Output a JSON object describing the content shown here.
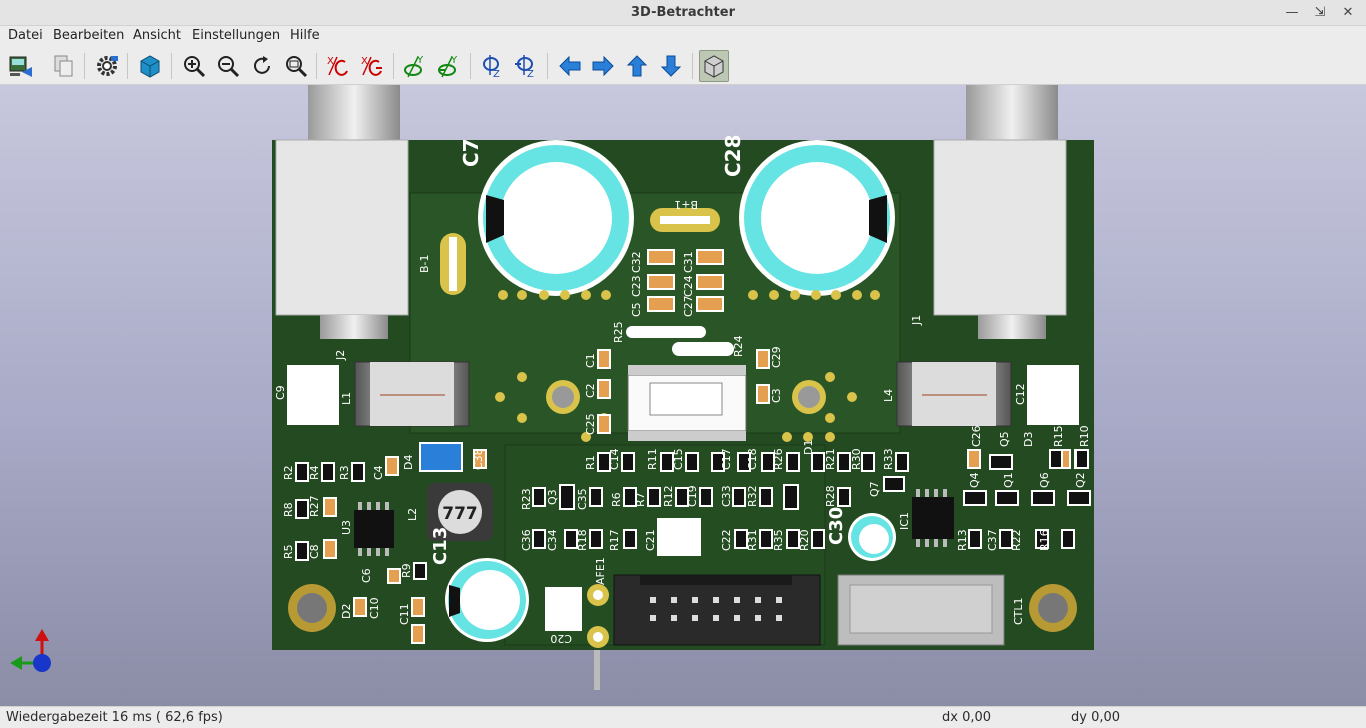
{
  "window": {
    "title": "3D-Betrachter"
  },
  "menu": {
    "items": [
      "Datei",
      "Bearbeiten",
      "Ansicht",
      "Einstellungen",
      "Hilfe"
    ]
  },
  "toolbar": {
    "buttons": [
      {
        "name": "pcb-export-icon"
      },
      {
        "name": "copy-icon"
      },
      {
        "name": "settings-gear-icon"
      },
      {
        "name": "3d-box-icon"
      },
      {
        "name": "zoom-in-icon"
      },
      {
        "name": "zoom-out-icon"
      },
      {
        "name": "redraw-icon"
      },
      {
        "name": "zoom-fit-icon"
      },
      {
        "name": "rotate-x-cw-icon"
      },
      {
        "name": "rotate-x-ccw-icon"
      },
      {
        "name": "rotate-y-cw-icon"
      },
      {
        "name": "rotate-y-ccw-icon"
      },
      {
        "name": "rotate-z-cw-icon"
      },
      {
        "name": "rotate-z-ccw-icon"
      },
      {
        "name": "move-left-icon"
      },
      {
        "name": "move-right-icon"
      },
      {
        "name": "move-up-icon"
      },
      {
        "name": "move-down-icon"
      },
      {
        "name": "orthographic-toggle-icon",
        "active": true
      }
    ]
  },
  "board": {
    "silkscreen": [
      "C7",
      "C28",
      "B+1",
      "B-1",
      "C32",
      "C23",
      "C5",
      "C31",
      "C24",
      "C27",
      "R25",
      "R24",
      "C1",
      "C29",
      "C2",
      "C3",
      "C25",
      "J2",
      "J1",
      "C9",
      "L1",
      "L4",
      "C12",
      "C26",
      "Q5",
      "D3",
      "R15",
      "R10",
      "R2",
      "R4",
      "R3",
      "C4",
      "D4",
      "C38",
      "R1",
      "C14",
      "R11",
      "C15",
      "C17",
      "C18",
      "R26",
      "D1",
      "R21",
      "R30",
      "R33",
      "R23",
      "C35",
      "Q3",
      "R6",
      "R7",
      "R12",
      "C19",
      "C33",
      "R32",
      "R28",
      "Q7",
      "Q4",
      "Q1",
      "Q6",
      "Q2",
      "R8",
      "R27",
      "U3",
      "L2",
      "C36",
      "C34",
      "R18",
      "R17",
      "C21",
      "C22",
      "R31",
      "R35",
      "R20",
      "C30",
      "IC1",
      "R13",
      "C37",
      "R22",
      "R16",
      "R5",
      "C8",
      "C13",
      "C6",
      "R9",
      "D2",
      "C10",
      "C11",
      "AFE1",
      "C20",
      "CTL1"
    ],
    "inductor_marking": "777"
  },
  "status": {
    "render_time": "Wiedergabezeit 16 ms ( 62,6 fps)",
    "dx": "dx 0,00",
    "dy": "dy 0,00"
  },
  "colors": {
    "pcb_green": "#234a20",
    "copper_fill": "#2a5526",
    "pad_gold": "#d9c34a",
    "cap_teal": "#66e3e3",
    "silk_white": "#ffffff",
    "window_bg": "#ececec"
  }
}
